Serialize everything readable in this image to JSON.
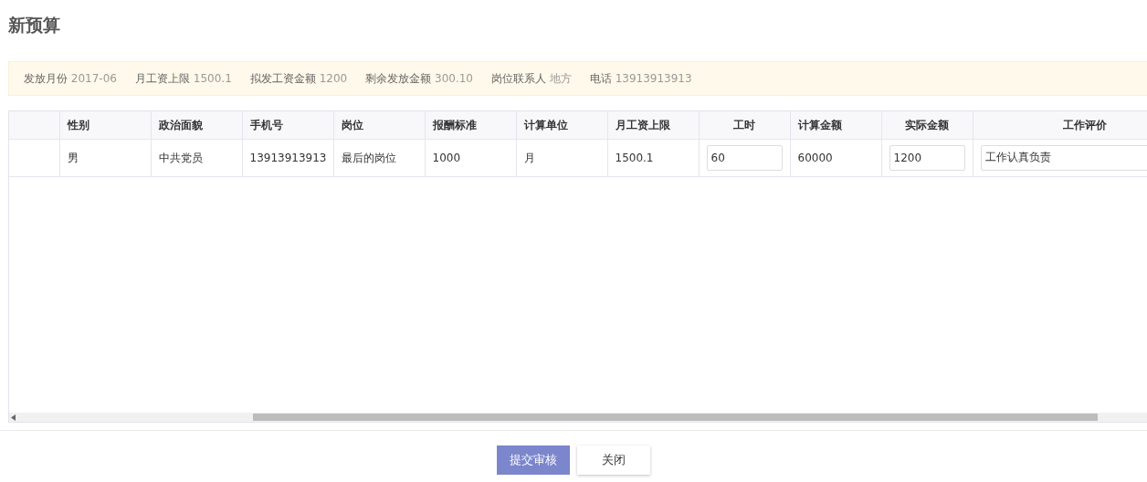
{
  "title": "新预算",
  "summary": [
    {
      "label": "发放月份",
      "value": "2017-06"
    },
    {
      "label": "月工资上限",
      "value": "1500.1"
    },
    {
      "label": "拟发工资金额",
      "value": "1200"
    },
    {
      "label": "剩余发放金额",
      "value": "300.10"
    },
    {
      "label": "岗位联系人",
      "value": "地方"
    },
    {
      "label": "电话",
      "value": "13913913913"
    }
  ],
  "table": {
    "columns": [
      {
        "label": "性别",
        "kind": "text"
      },
      {
        "label": "政治面貌",
        "kind": "text"
      },
      {
        "label": "手机号",
        "kind": "text"
      },
      {
        "label": "岗位",
        "kind": "text"
      },
      {
        "label": "报酬标准",
        "kind": "text"
      },
      {
        "label": "计算单位",
        "kind": "text"
      },
      {
        "label": "月工资上限",
        "kind": "text"
      },
      {
        "label": "工时",
        "kind": "input"
      },
      {
        "label": "计算金额",
        "kind": "text"
      },
      {
        "label": "实际金额",
        "kind": "input"
      },
      {
        "label": "工作评价",
        "kind": "input"
      }
    ],
    "rows": [
      [
        "男",
        "中共党员",
        "13913913913",
        "最后的岗位",
        "1000",
        "月",
        "1500.1",
        "60",
        "60000",
        "1200",
        "工作认真负责"
      ]
    ]
  },
  "buttons": [
    {
      "label": "提交审核",
      "kind": "primary"
    },
    {
      "label": "关闭",
      "kind": "secondary"
    }
  ]
}
